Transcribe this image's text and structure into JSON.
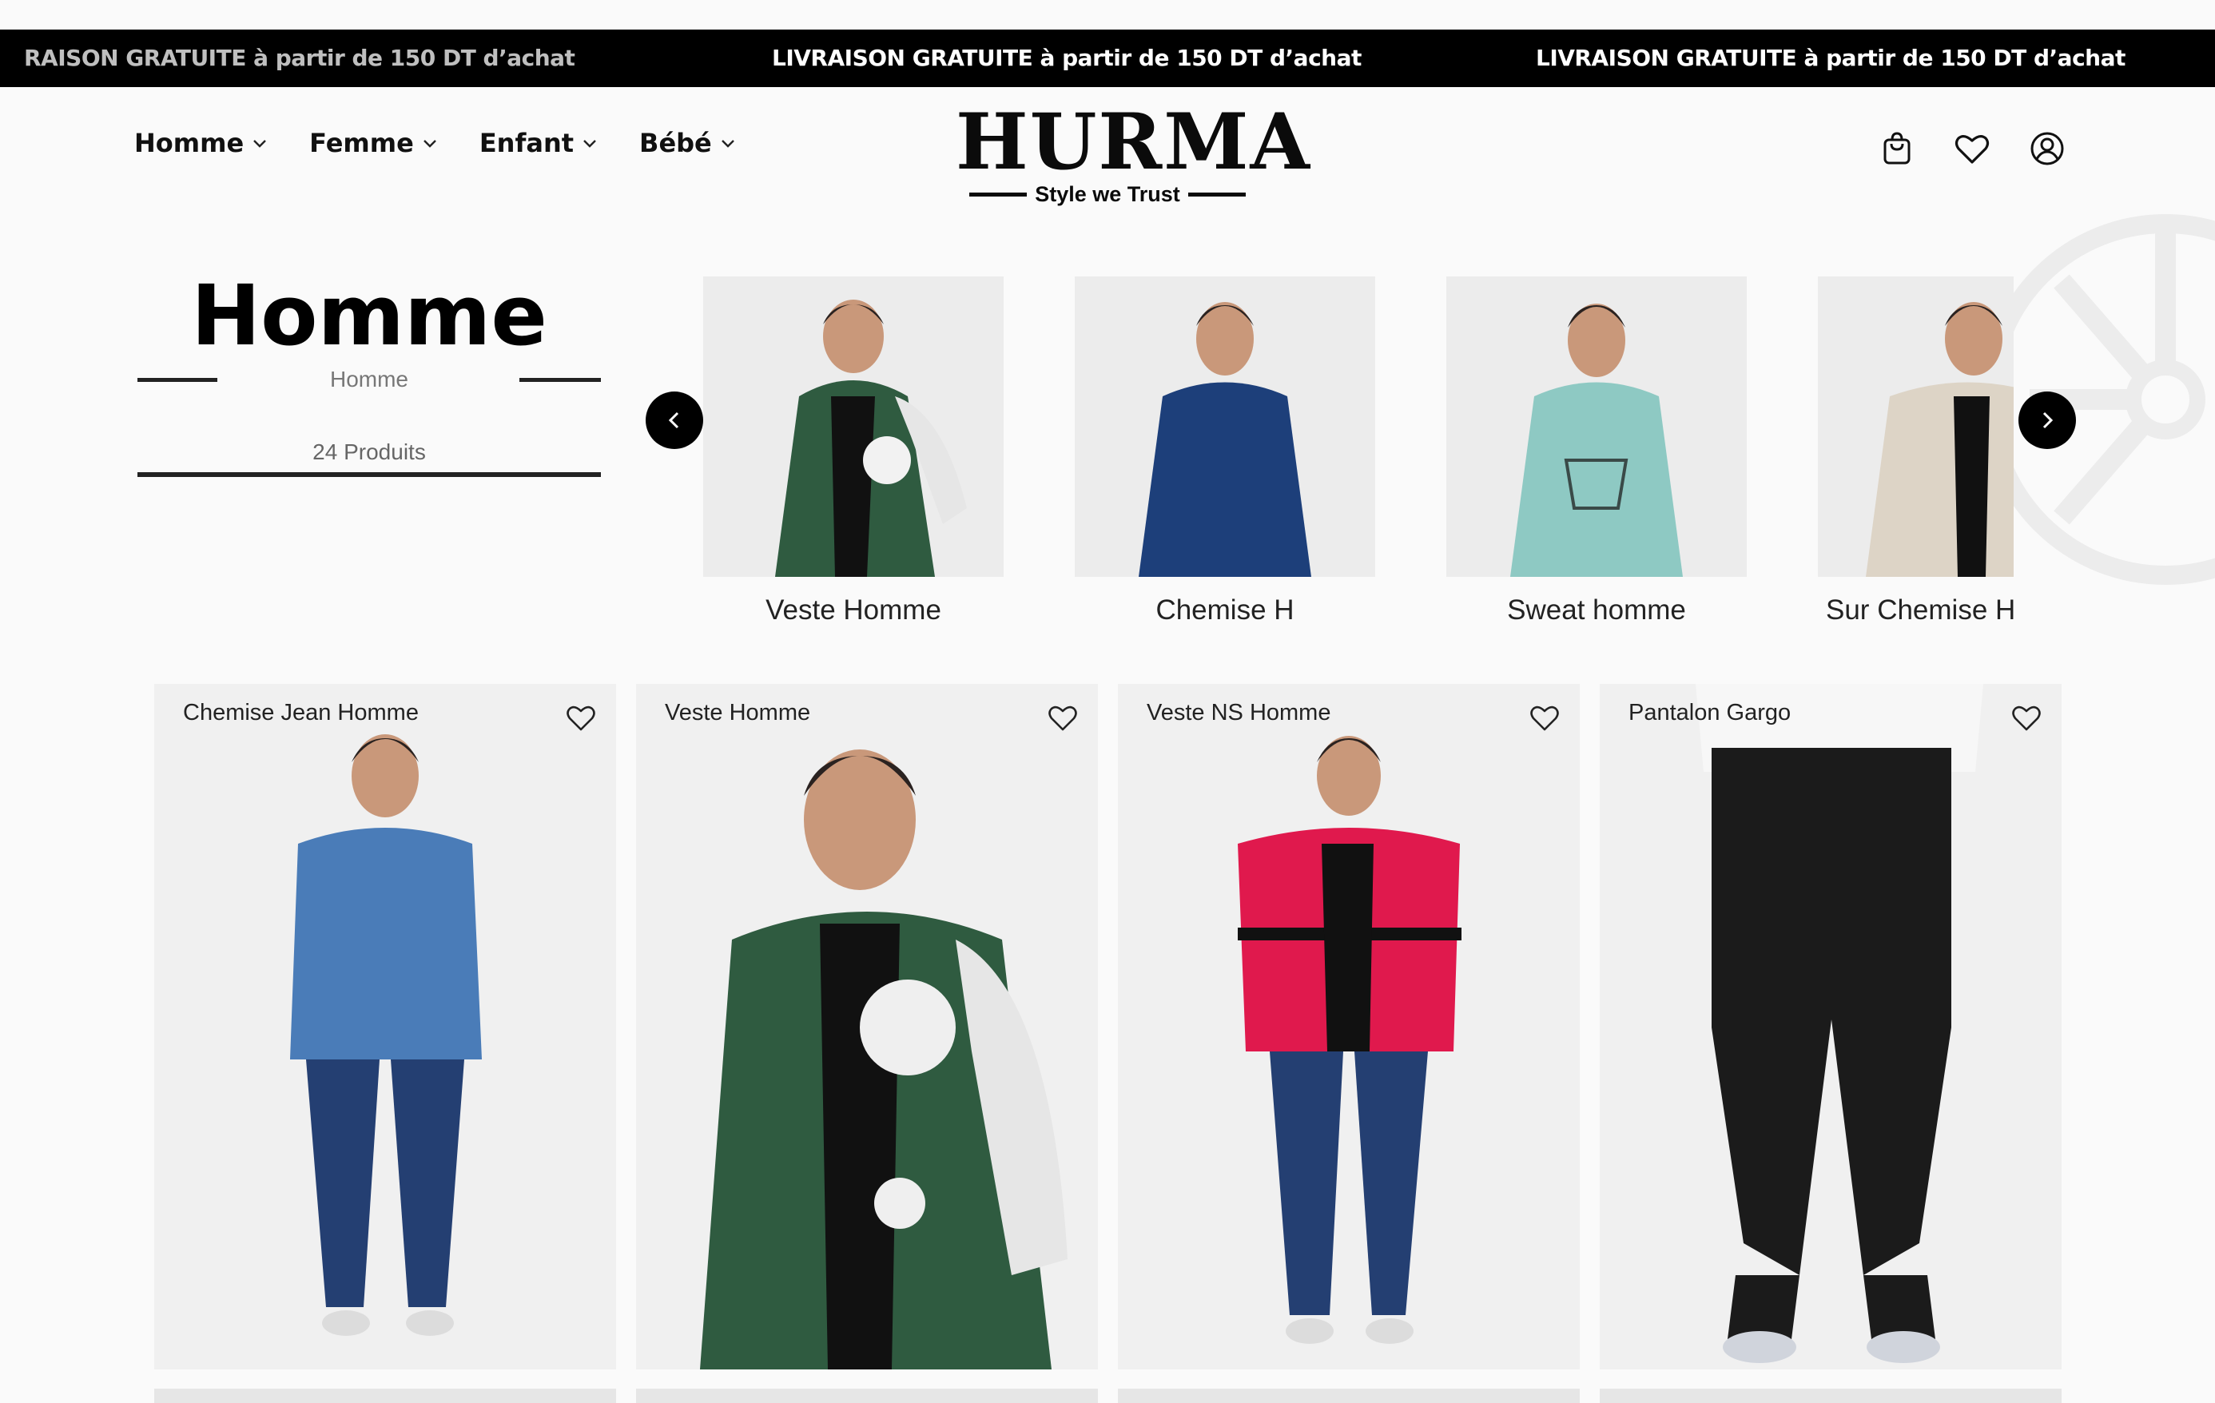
{
  "banner": {
    "items": [
      "RAISON GRATUITE à partir de 150 DT d’achat",
      "LIVRAISON GRATUITE à partir de 150 DT d’achat",
      "LIVRAISON GRATUITE à partir de 150 DT d’achat"
    ]
  },
  "nav": {
    "items": [
      "Homme",
      "Femme",
      "Enfant",
      "Bébé"
    ]
  },
  "logo": {
    "main": "HURMA",
    "tagline": "Style we Trust"
  },
  "header_icons": [
    "shopping-bag-icon",
    "heart-icon",
    "user-account-icon"
  ],
  "category": {
    "title": "Homme",
    "subtitle": "Homme",
    "count": "24 Produits"
  },
  "carousel": {
    "items": [
      {
        "label": "Veste Homme",
        "garment_color": "#2f5b40"
      },
      {
        "label": "Chemise H",
        "garment_color": "#1d3f7a"
      },
      {
        "label": "Sweat homme",
        "garment_color": "#8ec9c3"
      },
      {
        "label": "Sur Chemise H",
        "garment_color": "#ddd4c6"
      }
    ]
  },
  "products": [
    {
      "name": "Chemise Jean Homme",
      "garment_color": "#4a7cb8"
    },
    {
      "name": "Veste Homme",
      "garment_color": "#2f5b40"
    },
    {
      "name": "Veste NS Homme",
      "garment_color": "#e0194d"
    },
    {
      "name": "Pantalon Gargo",
      "garment_color": "#1b1b1b"
    }
  ],
  "colors": {
    "banner_bg": "#000000",
    "banner_text": "#ffffff",
    "accent": "#000000",
    "background": "#fafafa"
  }
}
